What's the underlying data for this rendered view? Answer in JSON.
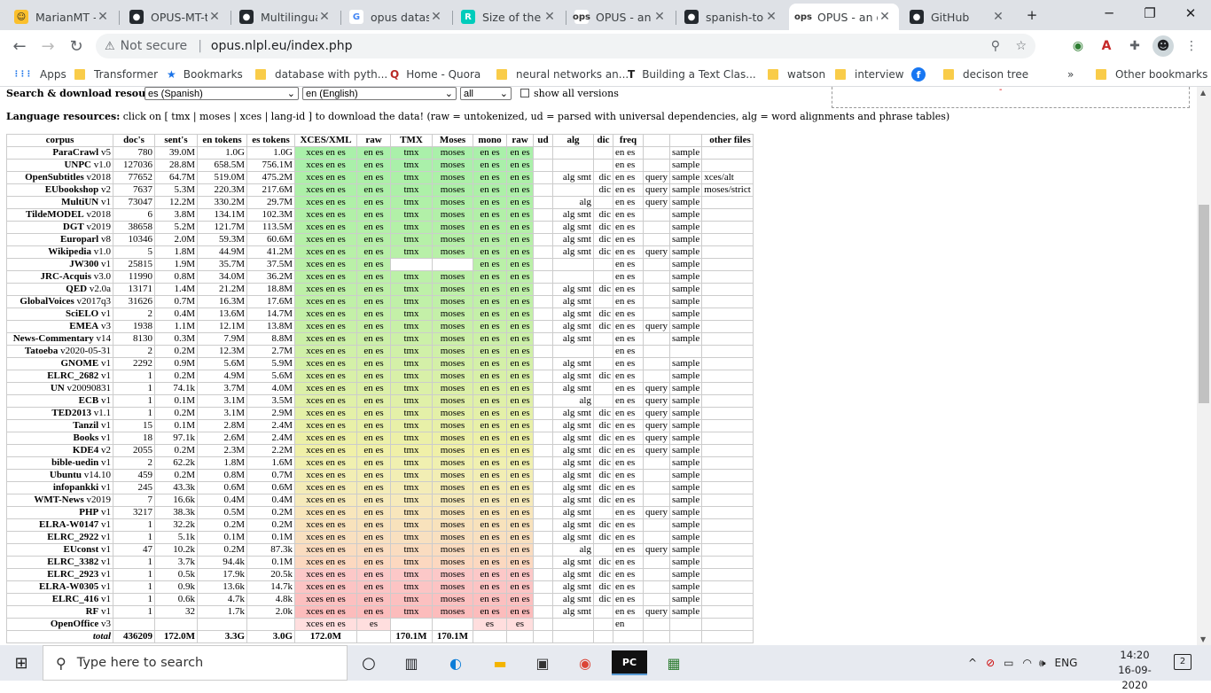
{
  "tabs": [
    {
      "title": "MarianMT -",
      "fav": "☺",
      "favbg": "#fbc02d",
      "favcolor": "#222"
    },
    {
      "title": "OPUS-MT-t",
      "fav": "●",
      "favbg": "#24292e",
      "favcolor": "#fff"
    },
    {
      "title": "Multilingua",
      "fav": "●",
      "favbg": "#24292e",
      "favcolor": "#fff"
    },
    {
      "title": "opus datase",
      "fav": "G",
      "favbg": "#fff",
      "favcolor": "#4285f4"
    },
    {
      "title": "Size of the t",
      "fav": "R",
      "favbg": "#00ccbb",
      "favcolor": "#fff"
    },
    {
      "title": "OPUS - an o",
      "fav": "ops",
      "favbg": "#fff",
      "favcolor": "#333"
    },
    {
      "title": "spanish-to-",
      "fav": "●",
      "favbg": "#24292e",
      "favcolor": "#fff"
    },
    {
      "title": "OPUS - an o",
      "fav": "ops",
      "favbg": "#fff",
      "favcolor": "#333"
    },
    {
      "title": "GitHub",
      "fav": "●",
      "favbg": "#24292e",
      "favcolor": "#fff"
    }
  ],
  "active_tab": 7,
  "new_tab": "+",
  "window": {
    "minimize": "─",
    "restore": "❐",
    "close": "✕"
  },
  "omnibox": {
    "warning": "⚠",
    "not_secure": "Not secure",
    "url": "opus.nlpl.eu/index.php"
  },
  "bookmarks": [
    {
      "label": "Apps",
      "icon": "apps"
    },
    {
      "label": "Transformer",
      "icon": "folder"
    },
    {
      "label": "Bookmarks",
      "icon": "star"
    },
    {
      "label": "database with pyth...",
      "icon": "folder"
    },
    {
      "label": "Home - Quora",
      "icon": "quora"
    },
    {
      "label": "neural networks an...",
      "icon": "folder"
    },
    {
      "label": "Building a Text Clas...",
      "icon": "tj"
    },
    {
      "label": "watson",
      "icon": "folder"
    },
    {
      "label": "interview",
      "icon": "folder"
    },
    {
      "label": "",
      "icon": "facebook"
    },
    {
      "label": "decison tree",
      "icon": "folder"
    }
  ],
  "bookmarks_more": "»",
  "other_bookmarks": "Other bookmarks",
  "search_bar": {
    "label": "Search & download resources:",
    "src_lang": "es (Spanish)",
    "trg_lang": "en (English)",
    "corpus": "all",
    "show_all": "show all versions"
  },
  "lang_resources": {
    "label": "Language resources:",
    "text": "click on [ tmx | moses | xces | lang-id ] to download the data! (raw = untokenized, ud = parsed with universal dependencies, alg = word alignments and phrase tables)"
  },
  "table": {
    "headers": [
      "corpus",
      "doc's",
      "sent's",
      "en tokens",
      "es tokens",
      "XCES/XML",
      "raw",
      "TMX",
      "Moses",
      "mono",
      "raw",
      "ud",
      "alg",
      "dic",
      "freq",
      "",
      "",
      "other files"
    ],
    "rows": [
      [
        "ParaCrawl",
        "v5",
        "780",
        "39.0M",
        "1.0G",
        "1.0G",
        "xces en es",
        "en es",
        "tmx",
        "moses",
        "en es",
        "en es",
        "",
        "",
        "",
        "en es",
        "",
        "sample",
        ""
      ],
      [
        "UNPC",
        "v1.0",
        "127036",
        "28.8M",
        "658.5M",
        "756.1M",
        "xces en es",
        "en es",
        "tmx",
        "moses",
        "en es",
        "en es",
        "",
        "",
        "",
        "en es",
        "",
        "sample",
        ""
      ],
      [
        "OpenSubtitles",
        "v2018",
        "77652",
        "64.7M",
        "519.0M",
        "475.2M",
        "xces en es",
        "en es",
        "tmx",
        "moses",
        "en es",
        "en es",
        "",
        "alg smt",
        "dic",
        "en es",
        "query",
        "sample",
        "xces/alt"
      ],
      [
        "EUbookshop",
        "v2",
        "7637",
        "5.3M",
        "220.3M",
        "217.6M",
        "xces en es",
        "en es",
        "tmx",
        "moses",
        "en es",
        "en es",
        "",
        "",
        "dic",
        "en es",
        "query",
        "sample",
        "moses/strict"
      ],
      [
        "MultiUN",
        "v1",
        "73047",
        "12.2M",
        "330.2M",
        "29.7M",
        "xces en es",
        "en es",
        "tmx",
        "moses",
        "en es",
        "en es",
        "",
        "alg",
        "",
        "en es",
        "query",
        "sample",
        ""
      ],
      [
        "TildeMODEL",
        "v2018",
        "6",
        "3.8M",
        "134.1M",
        "102.3M",
        "xces en es",
        "en es",
        "tmx",
        "moses",
        "en es",
        "en es",
        "",
        "alg smt",
        "dic",
        "en es",
        "",
        "sample",
        ""
      ],
      [
        "DGT",
        "v2019",
        "38658",
        "5.2M",
        "121.7M",
        "113.5M",
        "xces en es",
        "en es",
        "tmx",
        "moses",
        "en es",
        "en es",
        "",
        "alg smt",
        "dic",
        "en es",
        "",
        "sample",
        ""
      ],
      [
        "Europarl",
        "v8",
        "10346",
        "2.0M",
        "59.3M",
        "60.6M",
        "xces en es",
        "en es",
        "tmx",
        "moses",
        "en es",
        "en es",
        "",
        "alg smt",
        "dic",
        "en es",
        "",
        "sample",
        ""
      ],
      [
        "Wikipedia",
        "v1.0",
        "5",
        "1.8M",
        "44.9M",
        "41.2M",
        "xces en es",
        "en es",
        "tmx",
        "moses",
        "en es",
        "en es",
        "",
        "alg smt",
        "dic",
        "en es",
        "query",
        "sample",
        ""
      ],
      [
        "JW300",
        "v1",
        "25815",
        "1.9M",
        "35.7M",
        "37.5M",
        "xces en es",
        "en es",
        "",
        "",
        "en es",
        "en es",
        "",
        "",
        "",
        "en es",
        "",
        "sample",
        ""
      ],
      [
        "JRC-Acquis",
        "v3.0",
        "11990",
        "0.8M",
        "34.0M",
        "36.2M",
        "xces en es",
        "en es",
        "tmx",
        "moses",
        "en es",
        "en es",
        "",
        "",
        "",
        "en es",
        "",
        "sample",
        ""
      ],
      [
        "QED",
        "v2.0a",
        "13171",
        "1.4M",
        "21.2M",
        "18.8M",
        "xces en es",
        "en es",
        "tmx",
        "moses",
        "en es",
        "en es",
        "",
        "alg smt",
        "dic",
        "en es",
        "",
        "sample",
        ""
      ],
      [
        "GlobalVoices",
        "v2017q3",
        "31626",
        "0.7M",
        "16.3M",
        "17.6M",
        "xces en es",
        "en es",
        "tmx",
        "moses",
        "en es",
        "en es",
        "",
        "alg smt",
        "",
        "en es",
        "",
        "sample",
        ""
      ],
      [
        "SciELO",
        "v1",
        "2",
        "0.4M",
        "13.6M",
        "14.7M",
        "xces en es",
        "en es",
        "tmx",
        "moses",
        "en es",
        "en es",
        "",
        "alg smt",
        "dic",
        "en es",
        "",
        "sample",
        ""
      ],
      [
        "EMEA",
        "v3",
        "1938",
        "1.1M",
        "12.1M",
        "13.8M",
        "xces en es",
        "en es",
        "tmx",
        "moses",
        "en es",
        "en es",
        "",
        "alg smt",
        "dic",
        "en es",
        "query",
        "sample",
        ""
      ],
      [
        "News-Commentary",
        "v14",
        "8130",
        "0.3M",
        "7.9M",
        "8.8M",
        "xces en es",
        "en es",
        "tmx",
        "moses",
        "en es",
        "en es",
        "",
        "alg smt",
        "",
        "en es",
        "",
        "sample",
        ""
      ],
      [
        "Tatoeba",
        "v2020-05-31",
        "2",
        "0.2M",
        "12.3M",
        "2.7M",
        "xces en es",
        "en es",
        "tmx",
        "moses",
        "en es",
        "en es",
        "",
        "",
        "",
        "en es",
        "",
        "",
        ""
      ],
      [
        "GNOME",
        "v1",
        "2292",
        "0.9M",
        "5.6M",
        "5.9M",
        "xces en es",
        "en es",
        "tmx",
        "moses",
        "en es",
        "en es",
        "",
        "alg smt",
        "",
        "en es",
        "",
        "sample",
        ""
      ],
      [
        "ELRC_2682",
        "v1",
        "1",
        "0.2M",
        "4.9M",
        "5.6M",
        "xces en es",
        "en es",
        "tmx",
        "moses",
        "en es",
        "en es",
        "",
        "alg smt",
        "dic",
        "en es",
        "",
        "sample",
        ""
      ],
      [
        "UN",
        "v20090831",
        "1",
        "74.1k",
        "3.7M",
        "4.0M",
        "xces en es",
        "en es",
        "tmx",
        "moses",
        "en es",
        "en es",
        "",
        "alg smt",
        "",
        "en es",
        "query",
        "sample",
        ""
      ],
      [
        "ECB",
        "v1",
        "1",
        "0.1M",
        "3.1M",
        "3.5M",
        "xces en es",
        "en es",
        "tmx",
        "moses",
        "en es",
        "en es",
        "",
        "alg",
        "",
        "en es",
        "query",
        "sample",
        ""
      ],
      [
        "TED2013",
        "v1.1",
        "1",
        "0.2M",
        "3.1M",
        "2.9M",
        "xces en es",
        "en es",
        "tmx",
        "moses",
        "en es",
        "en es",
        "",
        "alg smt",
        "dic",
        "en es",
        "query",
        "sample",
        ""
      ],
      [
        "Tanzil",
        "v1",
        "15",
        "0.1M",
        "2.8M",
        "2.4M",
        "xces en es",
        "en es",
        "tmx",
        "moses",
        "en es",
        "en es",
        "",
        "alg smt",
        "dic",
        "en es",
        "query",
        "sample",
        ""
      ],
      [
        "Books",
        "v1",
        "18",
        "97.1k",
        "2.6M",
        "2.4M",
        "xces en es",
        "en es",
        "tmx",
        "moses",
        "en es",
        "en es",
        "",
        "alg smt",
        "dic",
        "en es",
        "query",
        "sample",
        ""
      ],
      [
        "KDE4",
        "v2",
        "2055",
        "0.2M",
        "2.3M",
        "2.2M",
        "xces en es",
        "en es",
        "tmx",
        "moses",
        "en es",
        "en es",
        "",
        "alg smt",
        "dic",
        "en es",
        "query",
        "sample",
        ""
      ],
      [
        "bible-uedin",
        "v1",
        "2",
        "62.2k",
        "1.8M",
        "1.6M",
        "xces en es",
        "en es",
        "tmx",
        "moses",
        "en es",
        "en es",
        "",
        "alg smt",
        "dic",
        "en es",
        "",
        "sample",
        ""
      ],
      [
        "Ubuntu",
        "v14.10",
        "459",
        "0.2M",
        "0.8M",
        "0.7M",
        "xces en es",
        "en es",
        "tmx",
        "moses",
        "en es",
        "en es",
        "",
        "alg smt",
        "dic",
        "en es",
        "",
        "sample",
        ""
      ],
      [
        "infopankki",
        "v1",
        "245",
        "43.3k",
        "0.6M",
        "0.6M",
        "xces en es",
        "en es",
        "tmx",
        "moses",
        "en es",
        "en es",
        "",
        "alg smt",
        "dic",
        "en es",
        "",
        "sample",
        ""
      ],
      [
        "WMT-News",
        "v2019",
        "7",
        "16.6k",
        "0.4M",
        "0.4M",
        "xces en es",
        "en es",
        "tmx",
        "moses",
        "en es",
        "en es",
        "",
        "alg smt",
        "dic",
        "en es",
        "",
        "sample",
        ""
      ],
      [
        "PHP",
        "v1",
        "3217",
        "38.3k",
        "0.5M",
        "0.2M",
        "xces en es",
        "en es",
        "tmx",
        "moses",
        "en es",
        "en es",
        "",
        "alg smt",
        "",
        "en es",
        "query",
        "sample",
        ""
      ],
      [
        "ELRA-W0147",
        "v1",
        "1",
        "32.2k",
        "0.2M",
        "0.2M",
        "xces en es",
        "en es",
        "tmx",
        "moses",
        "en es",
        "en es",
        "",
        "alg smt",
        "dic",
        "en es",
        "",
        "sample",
        ""
      ],
      [
        "ELRC_2922",
        "v1",
        "1",
        "5.1k",
        "0.1M",
        "0.1M",
        "xces en es",
        "en es",
        "tmx",
        "moses",
        "en es",
        "en es",
        "",
        "alg smt",
        "dic",
        "en es",
        "",
        "sample",
        ""
      ],
      [
        "EUconst",
        "v1",
        "47",
        "10.2k",
        "0.2M",
        "87.3k",
        "xces en es",
        "en es",
        "tmx",
        "moses",
        "en es",
        "en es",
        "",
        "alg",
        "",
        "en es",
        "query",
        "sample",
        ""
      ],
      [
        "ELRC_3382",
        "v1",
        "1",
        "3.7k",
        "94.4k",
        "0.1M",
        "xces en es",
        "en es",
        "tmx",
        "moses",
        "en es",
        "en es",
        "",
        "alg smt",
        "dic",
        "en es",
        "",
        "sample",
        ""
      ],
      [
        "ELRC_2923",
        "v1",
        "1",
        "0.5k",
        "17.9k",
        "20.5k",
        "xces en es",
        "en es",
        "tmx",
        "moses",
        "en es",
        "en es",
        "",
        "alg smt",
        "dic",
        "en es",
        "",
        "sample",
        ""
      ],
      [
        "ELRA-W0305",
        "v1",
        "1",
        "0.9k",
        "13.6k",
        "14.7k",
        "xces en es",
        "en es",
        "tmx",
        "moses",
        "en es",
        "en es",
        "",
        "alg smt",
        "dic",
        "en es",
        "",
        "sample",
        ""
      ],
      [
        "ELRC_416",
        "v1",
        "1",
        "0.6k",
        "4.7k",
        "4.8k",
        "xces en es",
        "en es",
        "tmx",
        "moses",
        "en es",
        "en es",
        "",
        "alg smt",
        "dic",
        "en es",
        "",
        "sample",
        ""
      ],
      [
        "RF",
        "v1",
        "1",
        "32",
        "1.7k",
        "2.0k",
        "xces en es",
        "en es",
        "tmx",
        "moses",
        "en es",
        "en es",
        "",
        "alg smt",
        "",
        "en es",
        "query",
        "sample",
        ""
      ],
      [
        "OpenOffice",
        "v3",
        "",
        "",
        "",
        "",
        "xces en es",
        "es",
        "",
        "",
        "es",
        "es",
        "",
        "",
        "",
        "en",
        "",
        "",
        ""
      ]
    ],
    "row_colors": [
      "#aaf0aa",
      "#aaf0aa",
      "#adf0a8",
      "#adf0a8",
      "#b0f0a8",
      "#b2f0a8",
      "#b4f0a8",
      "#b6f0a8",
      "#b8f0a8",
      "#baf0a8",
      "#bcf0a8",
      "#bef0a8",
      "#c0f0a8",
      "#c4f0a8",
      "#c8f0a8",
      "#ccf0a8",
      "#d0f0a8",
      "#d4f0a8",
      "#d8f0a8",
      "#dcf0a8",
      "#e0f0a8",
      "#e4f0a8",
      "#e8f0a8",
      "#ecf0a8",
      "#f0f0a8",
      "#f0f0b0",
      "#f2eeb4",
      "#f4ecb8",
      "#f6eabb",
      "#f8e6bc",
      "#f8e2bc",
      "#f8e0c0",
      "#fadcc0",
      "#fcd8c0",
      "#fcc8c8",
      "#fcc4c4",
      "#fcc0c0",
      "#fcbcbc",
      "#ffdede"
    ],
    "total": [
      "total",
      "436209",
      "172.0M",
      "3.3G",
      "3.0G",
      "172.0M",
      "",
      "170.1M",
      "170.1M"
    ]
  },
  "taskbar": {
    "search_placeholder": "Type here to search",
    "lang": "ENG",
    "time": "14:20",
    "date": "16-09-2020",
    "notif": "2"
  }
}
